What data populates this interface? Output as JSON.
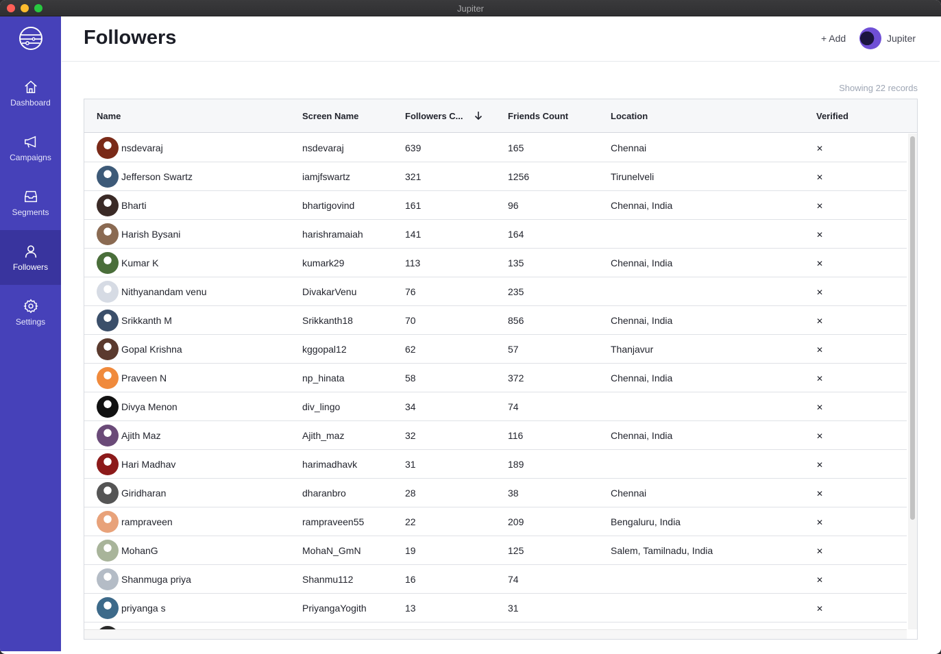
{
  "window": {
    "title": "Jupiter"
  },
  "sidebar": {
    "items": [
      {
        "label": "Dashboard",
        "icon": "home-icon"
      },
      {
        "label": "Campaigns",
        "icon": "megaphone-icon"
      },
      {
        "label": "Segments",
        "icon": "inbox-icon"
      },
      {
        "label": "Followers",
        "icon": "user-icon",
        "active": true
      },
      {
        "label": "Settings",
        "icon": "gear-icon"
      }
    ]
  },
  "header": {
    "title": "Followers",
    "add_label": "+ Add",
    "user_name": "Jupiter"
  },
  "table": {
    "records_text": "Showing 22 records",
    "columns": [
      "Name",
      "Screen Name",
      "Followers C...",
      "Friends Count",
      "Location",
      "Verified"
    ],
    "sort": {
      "column": "Followers C...",
      "direction": "descending"
    },
    "rows": [
      {
        "name": "nsdevaraj",
        "screen_name": "nsdevaraj",
        "followers": "639",
        "friends": "165",
        "location": "Chennai",
        "verified": "✕",
        "avatar_color": "#7a2a18"
      },
      {
        "name": "Jefferson Swartz",
        "screen_name": "iamjfswartz",
        "followers": "321",
        "friends": "1256",
        "location": "Tirunelveli",
        "verified": "✕",
        "avatar_color": "#3d5a78"
      },
      {
        "name": "Bharti",
        "screen_name": "bhartigovind",
        "followers": "161",
        "friends": "96",
        "location": "Chennai, India",
        "verified": "✕",
        "avatar_color": "#3a2a26"
      },
      {
        "name": "Harish Bysani",
        "screen_name": "harishramaiah",
        "followers": "141",
        "friends": "164",
        "location": "",
        "verified": "✕",
        "avatar_color": "#8a6a52"
      },
      {
        "name": "Kumar K",
        "screen_name": "kumark29",
        "followers": "113",
        "friends": "135",
        "location": "Chennai, India",
        "verified": "✕",
        "avatar_color": "#4a6e3a"
      },
      {
        "name": "Nithyanandam venu",
        "screen_name": "DivakarVenu",
        "followers": "76",
        "friends": "235",
        "location": "",
        "verified": "✕",
        "avatar_color": "#d6dbe4"
      },
      {
        "name": "Srikkanth M",
        "screen_name": "Srikkanth18",
        "followers": "70",
        "friends": "856",
        "location": "Chennai, India",
        "verified": "✕",
        "avatar_color": "#3b4f6a"
      },
      {
        "name": "Gopal Krishna",
        "screen_name": "kggopal12",
        "followers": "62",
        "friends": "57",
        "location": "Thanjavur",
        "verified": "✕",
        "avatar_color": "#5b3a2e"
      },
      {
        "name": "Praveen N",
        "screen_name": "np_hinata",
        "followers": "58",
        "friends": "372",
        "location": "Chennai, India",
        "verified": "✕",
        "avatar_color": "#f08a3c"
      },
      {
        "name": "Divya Menon",
        "screen_name": "div_lingo",
        "followers": "34",
        "friends": "74",
        "location": "",
        "verified": "✕",
        "avatar_color": "#111111"
      },
      {
        "name": "Ajith Maz",
        "screen_name": "Ajith_maz",
        "followers": "32",
        "friends": "116",
        "location": "Chennai, India",
        "verified": "✕",
        "avatar_color": "#6a4a78"
      },
      {
        "name": "Hari Madhav",
        "screen_name": "harimadhavk",
        "followers": "31",
        "friends": "189",
        "location": "",
        "verified": "✕",
        "avatar_color": "#8c1a1a"
      },
      {
        "name": "Giridharan",
        "screen_name": "dharanbro",
        "followers": "28",
        "friends": "38",
        "location": "Chennai",
        "verified": "✕",
        "avatar_color": "#555555"
      },
      {
        "name": "rampraveen",
        "screen_name": "rampraveen55",
        "followers": "22",
        "friends": "209",
        "location": "Bengaluru, India",
        "verified": "✕",
        "avatar_color": "#e8a27a"
      },
      {
        "name": "MohanG",
        "screen_name": "MohaN_GmN",
        "followers": "19",
        "friends": "125",
        "location": "Salem, Tamilnadu, India",
        "verified": "✕",
        "avatar_color": "#a8b49a"
      },
      {
        "name": "Shanmuga priya",
        "screen_name": "Shanmu112",
        "followers": "16",
        "friends": "74",
        "location": "",
        "verified": "✕",
        "avatar_color": "#b4bcc6"
      },
      {
        "name": "priyanga s",
        "screen_name": "PriyangaYogith",
        "followers": "13",
        "friends": "31",
        "location": "",
        "verified": "✕",
        "avatar_color": "#3d6a8a"
      }
    ]
  },
  "colors": {
    "sidebar": "#4641b9",
    "sidebar_active": "#39349e"
  }
}
